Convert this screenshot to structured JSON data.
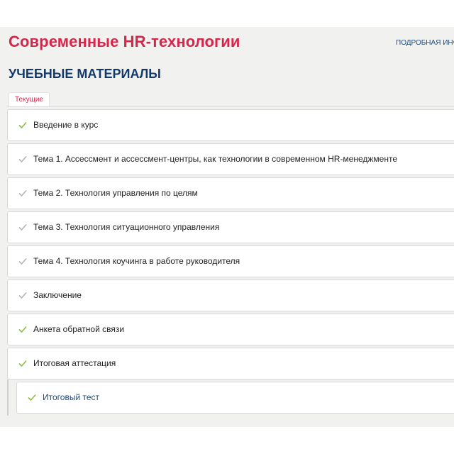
{
  "header": {
    "course_title": "Современные HR-технологии",
    "info_link": "ПОДРОБНАЯ ИНФ"
  },
  "section": {
    "title": "УЧЕБНЫЕ МАТЕРИАЛЫ",
    "tab_current": "Текущие"
  },
  "colors": {
    "accent_red": "#d7264a",
    "navy": "#143a6b",
    "check_done": "#8cbf3f",
    "check_pending": "#b5b5b5"
  },
  "items": [
    {
      "label": "Введение в курс",
      "check": "green"
    },
    {
      "label": "Тема 1. Ассессмент и ассессмент-центры, как технологии в современном HR-менеджменте",
      "check": "gray"
    },
    {
      "label": "Тема 2. Технология управления по целям",
      "check": "gray"
    },
    {
      "label": "Тема 3. Технология ситуационного управления",
      "check": "gray"
    },
    {
      "label": "Тема 4. Технология коучинга в работе руководителя",
      "check": "gray"
    },
    {
      "label": "Заключение",
      "check": "gray"
    },
    {
      "label": "Анкета обратной связи",
      "check": "green"
    },
    {
      "label": "Итоговая аттестация",
      "check": "green"
    }
  ],
  "subitems": [
    {
      "label": "Итоговый тест",
      "check": "green"
    }
  ],
  "icons": {
    "check": "check-icon"
  }
}
